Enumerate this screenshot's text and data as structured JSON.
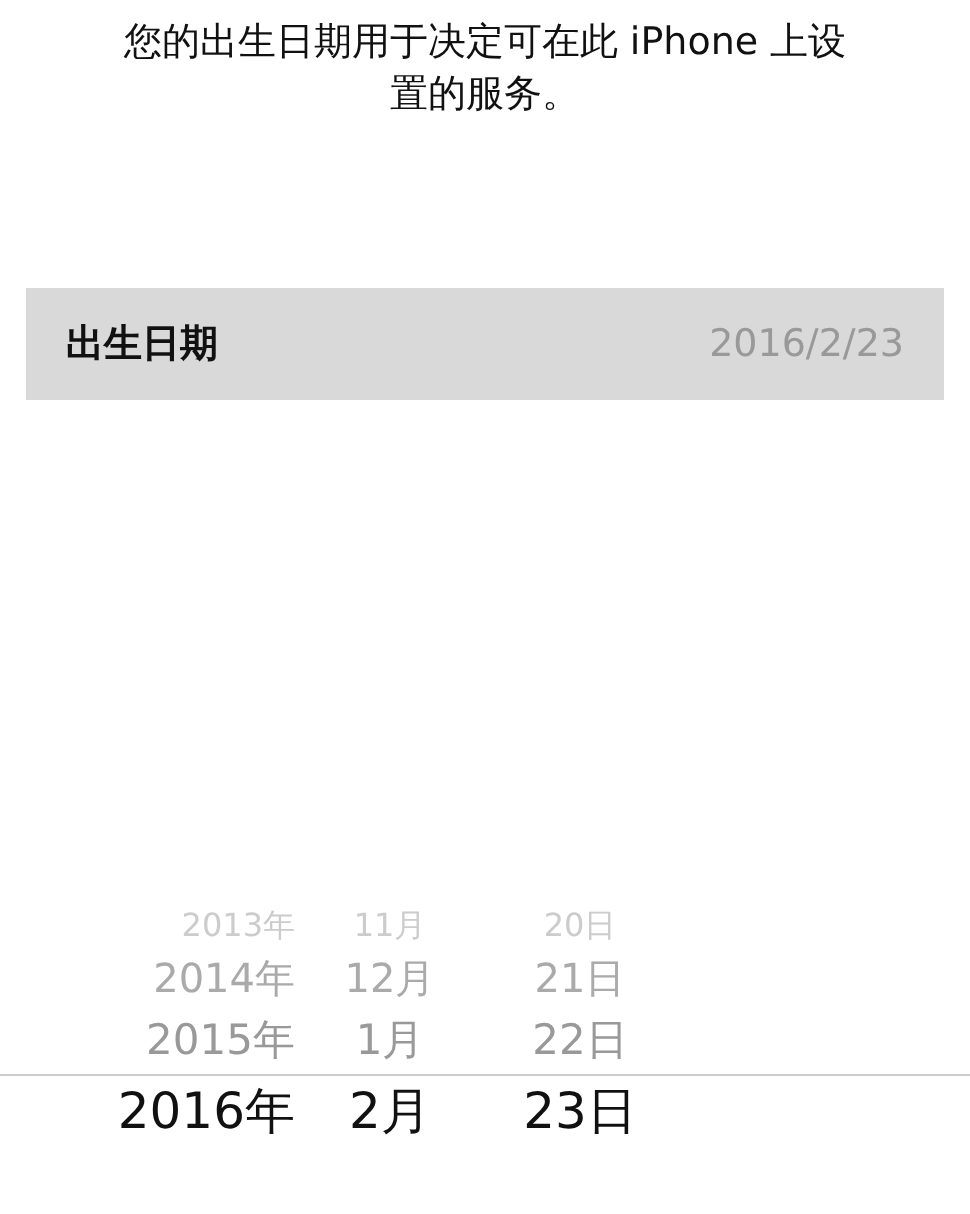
{
  "description": "您的出生日期用于决定可在此 iPhone 上设置的服务。",
  "birthday_row": {
    "label": "出生日期",
    "value": "2016/2/23",
    "selected": true
  },
  "picker": {
    "rows": [
      {
        "year": "2013年",
        "month": "11月",
        "day": "20日",
        "selected": false
      },
      {
        "year": "2014年",
        "month": "12月",
        "day": "21日",
        "selected": false
      },
      {
        "year": "2015年",
        "month": "1月",
        "day": "22日",
        "selected": false
      },
      {
        "year": "2016年",
        "month": "2月",
        "day": "23日",
        "selected": true
      }
    ]
  }
}
